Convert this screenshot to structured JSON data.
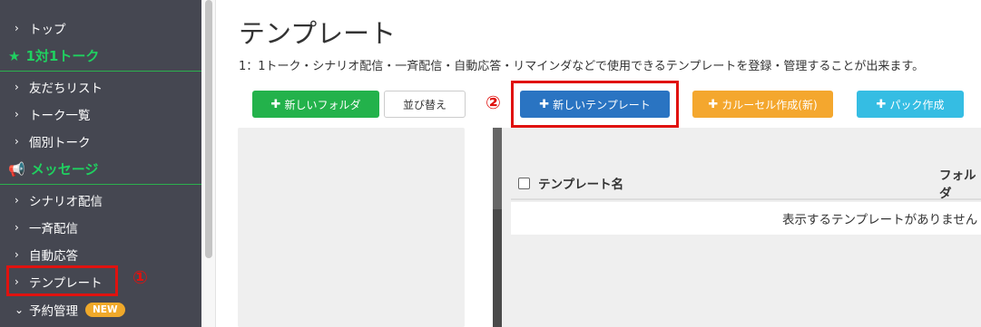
{
  "sidebar": {
    "top_label": "トップ",
    "section_talk": "1対1トーク",
    "talk_items": [
      "友だちリスト",
      "トーク一覧",
      "個別トーク"
    ],
    "section_message": "メッセージ",
    "message_items": [
      "シナリオ配信",
      "一斉配信",
      "自動応答",
      "テンプレート"
    ],
    "reservation_label": "予約管理",
    "new_badge": "NEW"
  },
  "page": {
    "title": "テンプレート",
    "description": "1：1トーク・シナリオ配信・一斉配信・自動応答・リマインダなどで使用できるテンプレートを登録・管理することが出来ます。"
  },
  "toolbar": {
    "new_folder": "新しいフォルダ",
    "sort": "並び替え",
    "new_template": "新しいテンプレート",
    "carousel": "カルーセル作成(新)",
    "pack": "パック作成"
  },
  "annotations": {
    "step1": "①",
    "step2": "②"
  },
  "table": {
    "col_name": "テンプレート名",
    "col_folder": "フォルダ",
    "empty_message": "表示するテンプレートがありません"
  },
  "colors": {
    "sidebar_bg": "#454751",
    "section_green": "#20d060",
    "highlight_red": "#e0120f",
    "primary_blue": "#2a74c2"
  }
}
